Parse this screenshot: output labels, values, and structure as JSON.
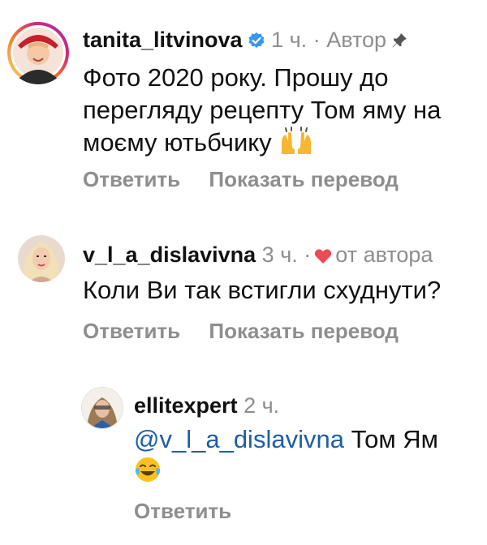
{
  "comments": [
    {
      "username": "tanita_litvinova",
      "verified": true,
      "time": "1 ч.",
      "separator": "·",
      "author_label": "Автор",
      "pin_icon": "pin-icon",
      "text_lines": [
        "Фото 2020 року. Прошу до",
        "перегляду рецепту Том яму на",
        "моєму ютьбчику"
      ],
      "emoji": "raising-hands-emoji",
      "reply_label": "Ответить",
      "translate_label": "Показать перевод"
    },
    {
      "username": "v_l_a_dislavivna",
      "time": "3 ч.",
      "separator": "·",
      "liked_by_author": "от автора",
      "heart_color": "#ed4956",
      "text": "Коли Ви так встигли схуднути?",
      "reply_label": "Ответить",
      "translate_label": "Показать перевод"
    }
  ],
  "reply": {
    "username": "ellitexpert",
    "time": "2 ч.",
    "mention": "@v_l_a_dislavivna",
    "text": "Том Ям",
    "emoji": "tears-of-joy-emoji",
    "reply_label": "Ответить"
  },
  "colors": {
    "mention": "#1c5ea8",
    "verified": "#3897f0",
    "story_ring": "#d6249f",
    "muted": "#8e8e8e"
  }
}
